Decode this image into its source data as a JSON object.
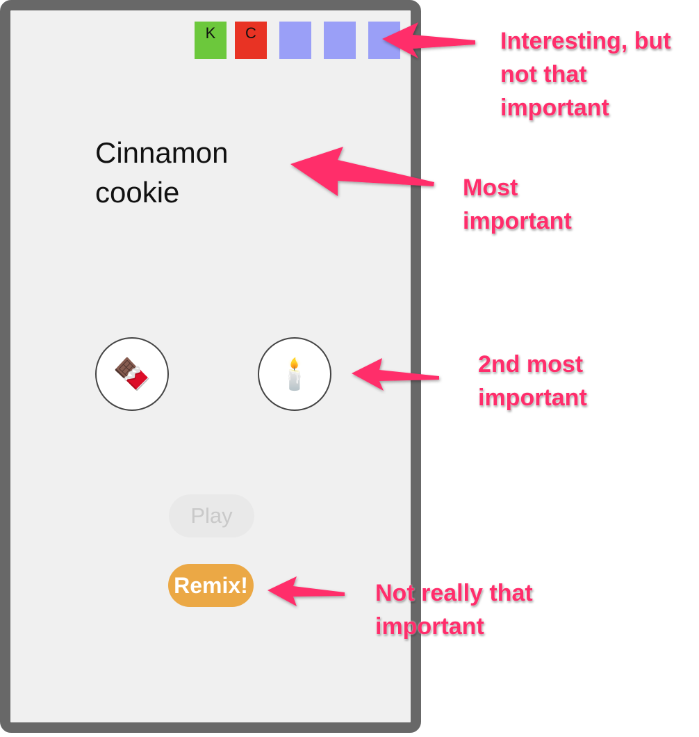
{
  "app": {
    "tiles": [
      {
        "label": "K",
        "color": "#6cc83c"
      },
      {
        "label": "C",
        "color": "#e83324"
      },
      {
        "label": "",
        "color": "#9a9ff7"
      },
      {
        "label": "",
        "color": "#9a9ff7"
      },
      {
        "label": "",
        "color": "#9a9ff7"
      }
    ],
    "title": "Cinnamon cookie",
    "options": [
      {
        "icon": "chocolate-bar-icon",
        "glyph": "🍫"
      },
      {
        "icon": "candle-icon",
        "glyph": "🕯️"
      }
    ],
    "play_label": "Play",
    "remix_label": "Remix!"
  },
  "annotations": {
    "tiles_note": "Interesting, but not that important",
    "title_note": "Most important",
    "options_note": "2nd most important",
    "remix_note": "Not really that important",
    "color": "#ff2d6b"
  }
}
